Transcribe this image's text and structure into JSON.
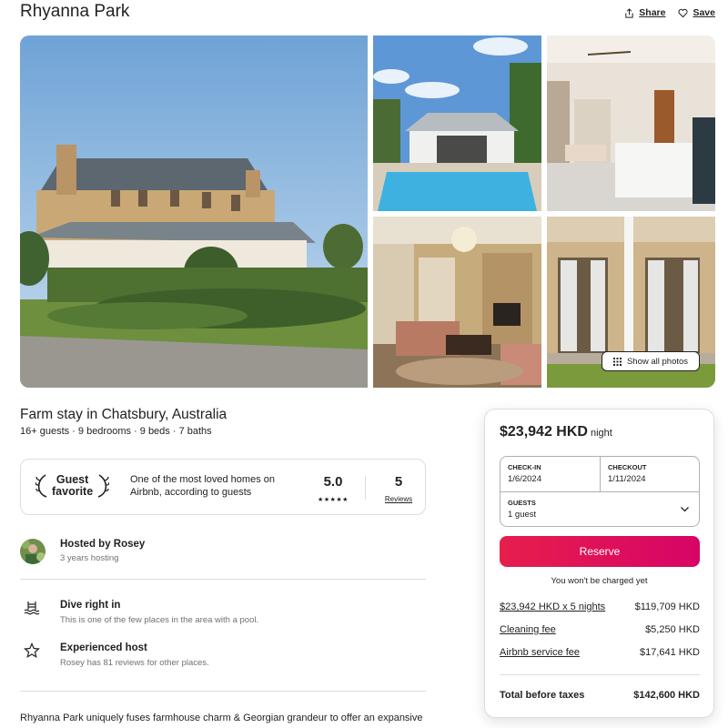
{
  "header": {
    "title": "Rhyanna Park",
    "share_label": "Share",
    "save_label": "Save"
  },
  "gallery": {
    "show_all_label": "Show all photos"
  },
  "listing": {
    "title": "Farm stay in Chatsbury, Australia",
    "subtitle": "16+ guests · 9 bedrooms · 9 beds · 7 baths"
  },
  "guest_favorite": {
    "label_line1": "Guest",
    "label_line2": "favorite",
    "description": "One of the most loved homes on Airbnb, according to guests",
    "rating": "5.0",
    "stars": "★★★★★",
    "review_count": "5",
    "reviews_label": "Reviews"
  },
  "host": {
    "name": "Hosted by Rosey",
    "tenure": "3 years hosting"
  },
  "features": [
    {
      "title": "Dive right in",
      "subtitle": "This is one of the few places in the area with a pool."
    },
    {
      "title": "Experienced host",
      "subtitle": "Rosey has 81 reviews for other places."
    }
  ],
  "description": "Rhyanna Park uniquely fuses farmhouse charm & Georgian grandeur to offer an expansive",
  "booking": {
    "price": "$23,942 HKD",
    "per": "night",
    "checkin_label": "CHECK-IN",
    "checkin_value": "1/6/2024",
    "checkout_label": "CHECKOUT",
    "checkout_value": "1/11/2024",
    "guests_label": "GUESTS",
    "guests_value": "1 guest",
    "reserve_label": "Reserve",
    "no_charge": "You won't be charged yet",
    "lines": [
      {
        "label": "$23,942 HKD x 5 nights",
        "amount": "$119,709 HKD"
      },
      {
        "label": "Cleaning fee",
        "amount": "$5,250 HKD"
      },
      {
        "label": "Airbnb service fee",
        "amount": "$17,641 HKD"
      }
    ],
    "total_label": "Total before taxes",
    "total_amount": "$142,600 HKD"
  },
  "colors": {
    "reserve_start": "#e61e4d",
    "reserve_end": "#d70466",
    "muted_text": "#717171",
    "border": "#dddddd"
  }
}
